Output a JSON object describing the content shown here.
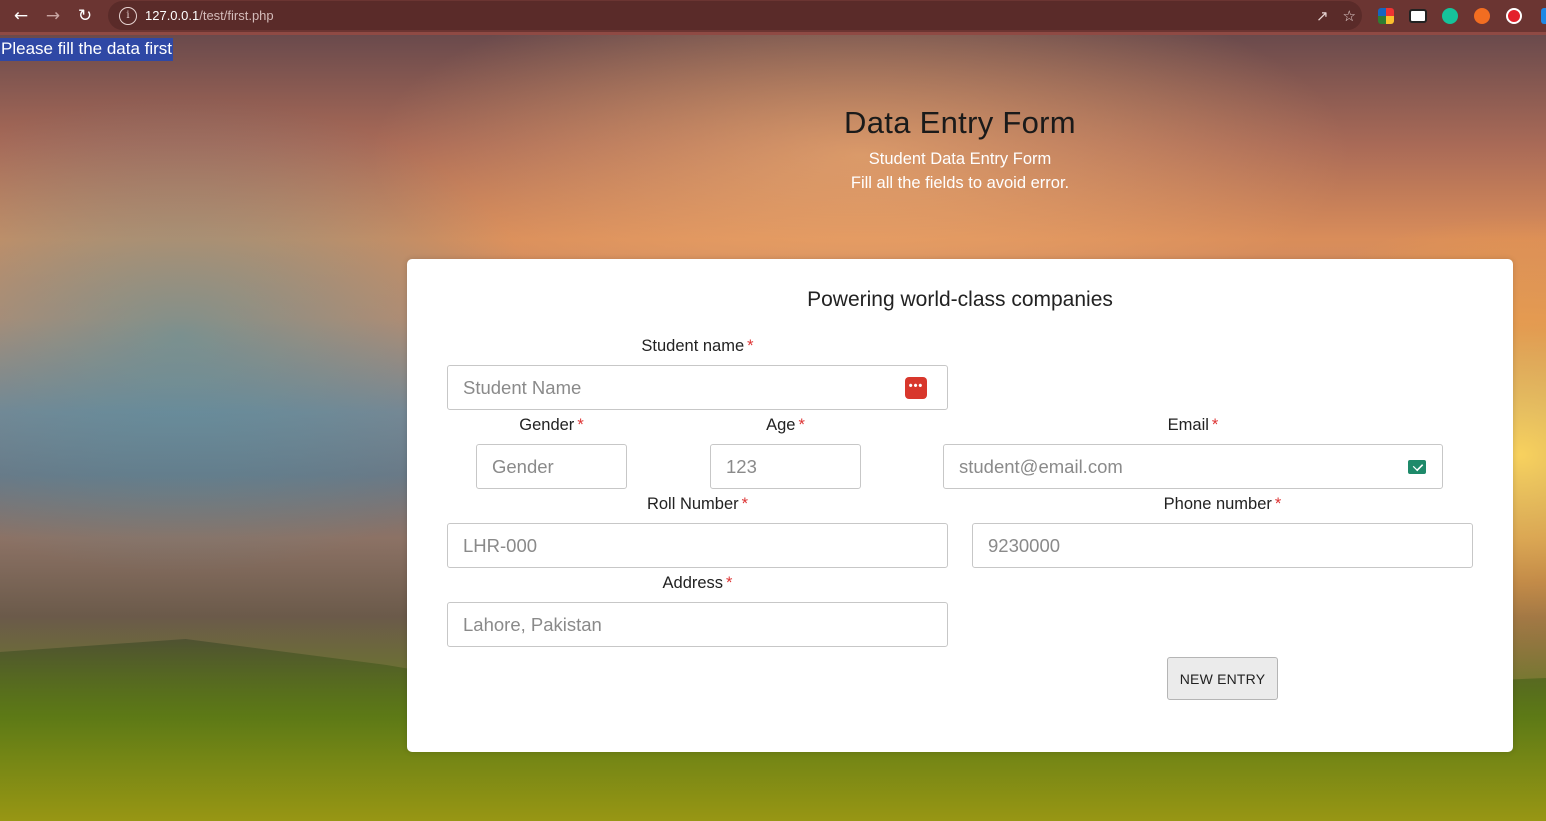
{
  "browser": {
    "url_host": "127.0.0.1",
    "url_path": "/test/first.php",
    "info_icon": "info-icon",
    "icons": {
      "back": "back-arrow-icon",
      "forward": "forward-arrow-icon",
      "reload": "reload-icon",
      "share": "share-icon",
      "bookmark": "star-icon"
    },
    "extensions": [
      "extension-puzzle-icon",
      "extension-adblock-icon",
      "grammarly-icon",
      "extension-orange-icon",
      "extension-red-icon",
      "extension-blue-icon"
    ],
    "chrome_color": "#6b3532"
  },
  "alert": {
    "text": "Please fill the data first"
  },
  "hero": {
    "title": "Data Entry Form",
    "subtitle_line1": "Student Data Entry Form",
    "subtitle_line2": "Fill all the fields to avoid error."
  },
  "form": {
    "title": "Powering world-class companies",
    "required_mark": "*",
    "student_name": {
      "label": "Student name",
      "placeholder": "Student Name",
      "icon": "password-manager-icon"
    },
    "gender": {
      "label": "Gender",
      "placeholder": "Gender"
    },
    "age": {
      "label": "Age",
      "placeholder": "123"
    },
    "email": {
      "label": "Email",
      "placeholder": "student@email.com",
      "icon": "email-icon"
    },
    "roll_number": {
      "label": "Roll Number",
      "placeholder": "LHR-000"
    },
    "phone": {
      "label": "Phone number",
      "placeholder": "9230000"
    },
    "address": {
      "label": "Address",
      "placeholder": "Lahore, Pakistan"
    },
    "submit_label": "NEW ENTRY"
  },
  "colors": {
    "alert_bg": "#2f48a5",
    "required": "#dd3333",
    "password_icon": "#d8372c",
    "email_icon": "#1e8a6a"
  }
}
